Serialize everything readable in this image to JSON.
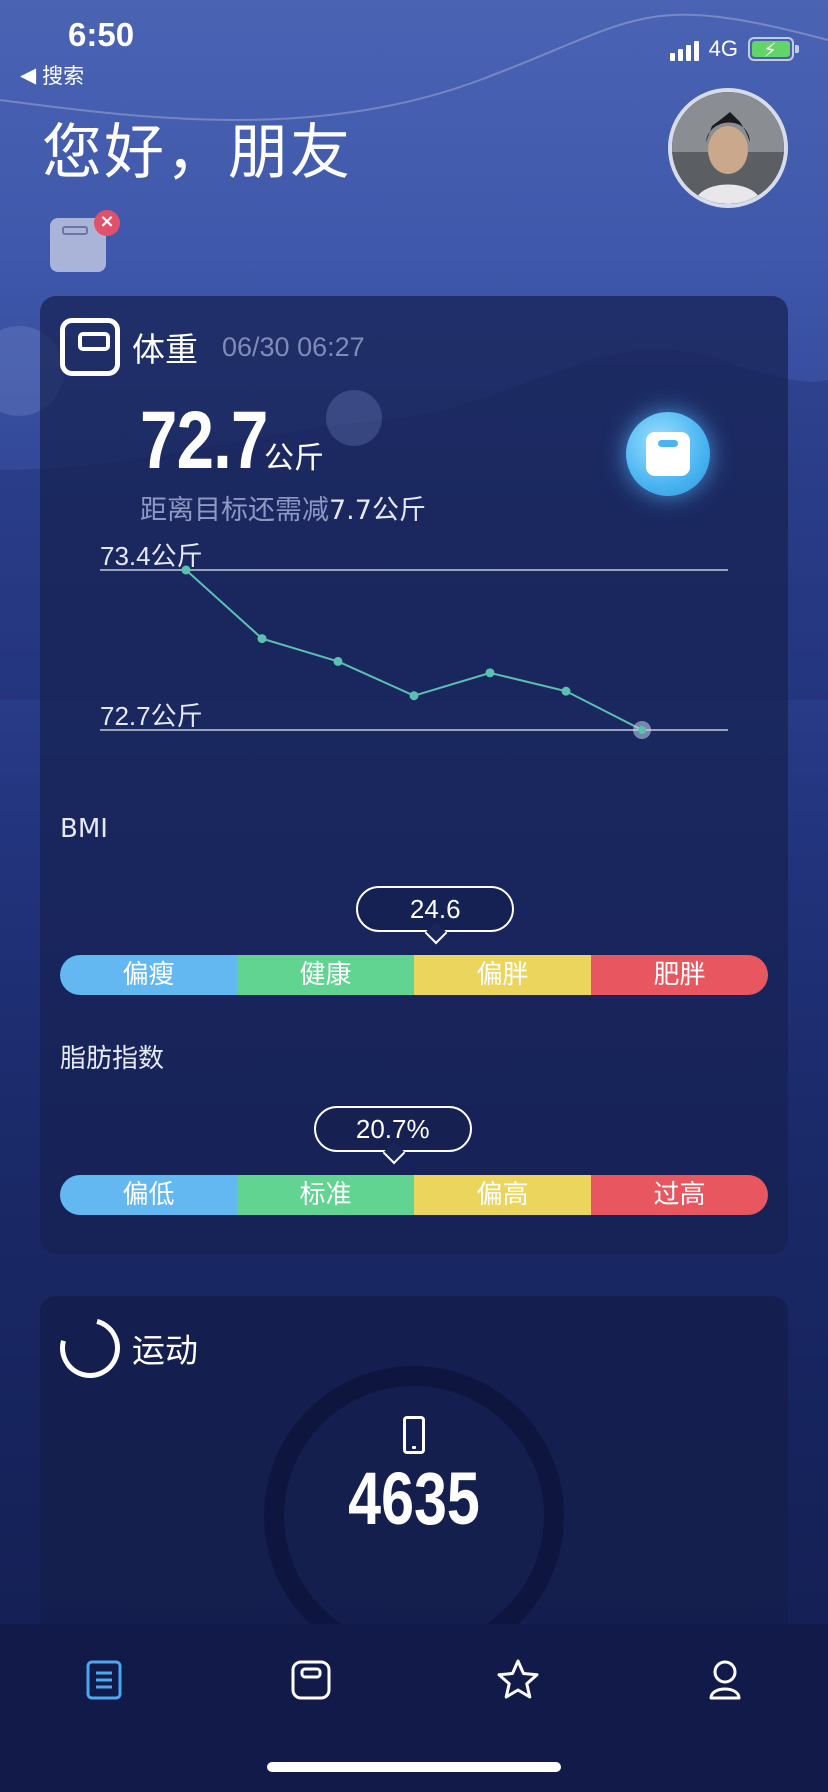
{
  "status_bar": {
    "time": "6:50",
    "back_label": "搜索",
    "network": "4G"
  },
  "header": {
    "greeting": "您好，朋友"
  },
  "weight_card": {
    "title": "体重",
    "datetime": "06/30 06:27",
    "value": "72.7",
    "unit": "公斤",
    "goal_prefix": "距离目标还需减",
    "goal_value": "7.7公斤",
    "trend": {
      "max_label": "73.4公斤",
      "min_label": "72.7公斤",
      "values": [
        73.4,
        73.1,
        73.0,
        72.85,
        72.95,
        72.87,
        72.7
      ],
      "min": 72.7,
      "max": 73.4
    }
  },
  "bmi": {
    "label": "BMI",
    "value": "24.6",
    "position": 0.53,
    "segments": [
      "偏瘦",
      "健康",
      "偏胖",
      "肥胖"
    ]
  },
  "body_fat": {
    "label": "脂肪指数",
    "value": "20.7%",
    "position": 0.47,
    "segments": [
      "偏低",
      "标准",
      "偏高",
      "过高"
    ]
  },
  "sport_card": {
    "title": "运动",
    "steps": "4635"
  },
  "tabbar": {
    "items": [
      "home-icon",
      "scale-icon",
      "star-icon",
      "profile-icon"
    ],
    "active_color": "#4ea6f0"
  },
  "colors": {
    "segment_1": "#63b8f2",
    "segment_2": "#62d491",
    "segment_3": "#ecd55c",
    "segment_4": "#e8575f",
    "trend_line": "#5bc0b0"
  }
}
